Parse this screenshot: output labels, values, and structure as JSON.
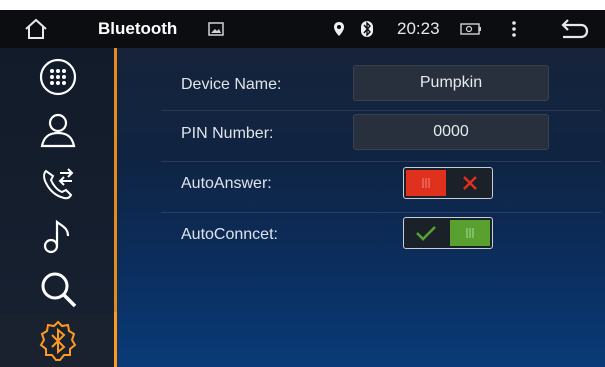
{
  "status_bar": {
    "title": "Bluetooth",
    "time": "20:23"
  },
  "icons": {
    "home": "home-icon",
    "gallery": "gallery-icon",
    "location": "location-pin-icon",
    "bluetooth": "bluetooth-icon",
    "battery": "battery-icon",
    "menu": "more-vert-icon",
    "back": "back-icon",
    "nav": [
      "dialpad-icon",
      "contacts-icon",
      "call-log-icon",
      "music-icon",
      "search-icon",
      "bluetooth-settings-icon"
    ]
  },
  "sidebar": {
    "active_index": 5
  },
  "settings": {
    "device_name_label": "Device Name:",
    "device_name_value": "Pumpkin",
    "pin_label": "PIN Number:",
    "pin_value": "0000",
    "auto_answer_label": "AutoAnswer:",
    "auto_answer_on": false,
    "auto_connect_label": "AutoConncet:",
    "auto_connect_on": true
  },
  "colors": {
    "accent": "#e58a1c",
    "toggle_off": "#e0301e",
    "toggle_on": "#58a030"
  }
}
